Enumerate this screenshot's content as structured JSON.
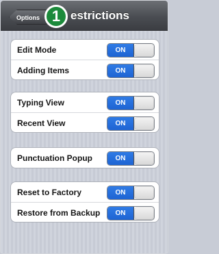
{
  "colors": {
    "nav_bar": "#4a4d52",
    "switch_on": "#2f7be5",
    "step_badge": "#1c8a3b",
    "group_background": "#ffffff"
  },
  "nav": {
    "back_label": "Options",
    "title": "estrictions",
    "step_number": "1",
    "back_icon": "chevron-left-icon"
  },
  "groups": [
    {
      "rows": [
        {
          "label": "Edit Mode",
          "toggle": "ON",
          "state": true
        },
        {
          "label": "Adding Items",
          "toggle": "ON",
          "state": true
        }
      ]
    },
    {
      "rows": [
        {
          "label": "Typing View",
          "toggle": "ON",
          "state": true
        },
        {
          "label": "Recent View",
          "toggle": "ON",
          "state": true
        }
      ]
    },
    {
      "rows": [
        {
          "label": "Punctuation Popup",
          "toggle": "ON",
          "state": true
        }
      ]
    },
    {
      "rows": [
        {
          "label": "Reset to Factory",
          "toggle": "ON",
          "state": true
        },
        {
          "label": "Restore from Backup",
          "toggle": "ON",
          "state": true
        }
      ]
    }
  ]
}
